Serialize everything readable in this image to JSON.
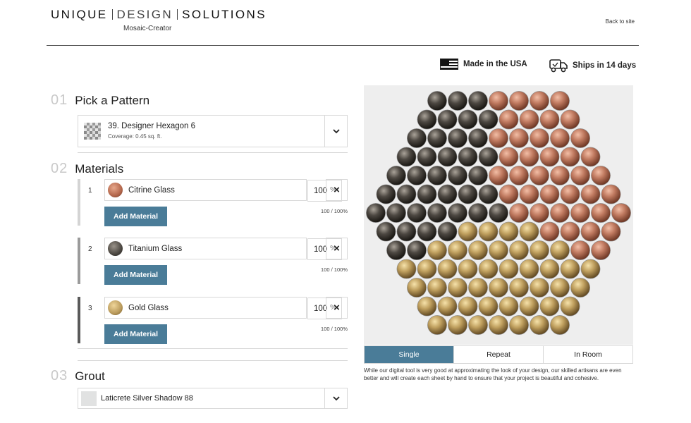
{
  "header": {
    "brand": {
      "word1": "UNIQUE",
      "word2": "DESIGN",
      "word3": "SOLUTIONS"
    },
    "subtitle": "Mosaic-Creator",
    "back_link": "Back to site"
  },
  "badges": [
    {
      "label": "Made in the USA",
      "icon": "us-flag-icon"
    },
    {
      "label": "Ships in 14 days",
      "icon": "delivery-truck-icon"
    }
  ],
  "steps": {
    "pattern": {
      "number": "01",
      "title": "Pick a Pattern",
      "selected_name": "39. Designer Hexagon 6",
      "coverage": "Coverage: 0.45 sq. ft."
    },
    "materials": {
      "number": "02",
      "title": "Materials",
      "items": [
        {
          "index": "1",
          "name": "Citrine Glass",
          "percent": "100",
          "pct_sign": "%",
          "add_label": "Add Material",
          "total": "100 / 100%",
          "color": "#c07a60",
          "bar_color": "#d4d4d4"
        },
        {
          "index": "2",
          "name": "Titanium Glass",
          "percent": "100",
          "pct_sign": "%",
          "add_label": "Add Material",
          "total": "100 / 100%",
          "color": "#4a4640",
          "bar_color": "#9b9b9b"
        },
        {
          "index": "3",
          "name": "Gold Glass",
          "percent": "100",
          "pct_sign": "%",
          "add_label": "Add Material",
          "total": "100 / 100%",
          "color": "#b8995a",
          "bar_color": "#5a5a5a"
        }
      ],
      "remove_label": "×"
    },
    "grout": {
      "number": "03",
      "title": "Grout",
      "selected_name": "Laticrete Silver Shadow 88",
      "color": "#e1e2e2"
    }
  },
  "preview": {
    "tabs": [
      {
        "label": "Single",
        "active": true
      },
      {
        "label": "Repeat",
        "active": false
      },
      {
        "label": "In Room",
        "active": false
      }
    ],
    "note": "While our digital tool is very good at approximating the look of your design, our skilled artisans are even better and will create each sheet by hand to ensure that your project is beautiful and cohesive."
  },
  "colors": {
    "accent": "#4a7c98",
    "citrine": "#c07a60",
    "titanium": "#4a4640",
    "gold": "#b8995a"
  }
}
